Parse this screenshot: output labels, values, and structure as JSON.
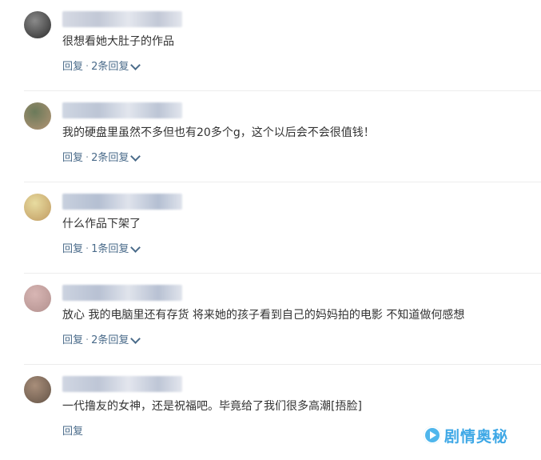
{
  "comments": [
    {
      "text": "很想看她大肚子的作品",
      "reply_label": "回复",
      "more_label": "2条回复",
      "avatar_colors": [
        "#8a8a8a",
        "#3a3a3a"
      ],
      "name_blur_colors": [
        "#d6dae4",
        "#c2c8d6",
        "#e4e7ee"
      ]
    },
    {
      "text": "我的硬盘里虽然不多但也有20多个g，这个以后会不会很值钱！",
      "reply_label": "回复",
      "more_label": "2条回复",
      "avatar_colors": [
        "#6b7a5a",
        "#a89070"
      ],
      "name_blur_colors": [
        "#cfd6e2",
        "#bcc5d5",
        "#e2e6ee"
      ]
    },
    {
      "text": "什么作品下架了",
      "reply_label": "回复",
      "more_label": "1条回复",
      "avatar_colors": [
        "#e8dca0",
        "#c6a46a"
      ],
      "name_blur_colors": [
        "#c8d0de",
        "#b4bfd2",
        "#dfe3ec"
      ]
    },
    {
      "text": "放心 我的电脑里还有存货 将来她的孩子看到自己的妈妈拍的电影 不知道做何感想",
      "reply_label": "回复",
      "more_label": "2条回复",
      "avatar_colors": [
        "#d8b6b4",
        "#b89694"
      ],
      "name_blur_colors": [
        "#ccd3e0",
        "#b8c1d3",
        "#e0e4ec"
      ]
    },
    {
      "text": "一代撸友的女神，还是祝福吧。毕竟给了我们很多高潮[捂脸]",
      "reply_label": "回复",
      "more_label": "",
      "avatar_colors": [
        "#a88e7a",
        "#6e5c4e"
      ],
      "name_blur_colors": [
        "#d0d6e2",
        "#bec6d6",
        "#e3e6ee"
      ]
    }
  ],
  "separator": "·",
  "watermark": {
    "text": "剧情奥秘",
    "color": "#3fa8e6"
  },
  "colors": {
    "link": "#4a6b8a",
    "text": "#333333"
  }
}
